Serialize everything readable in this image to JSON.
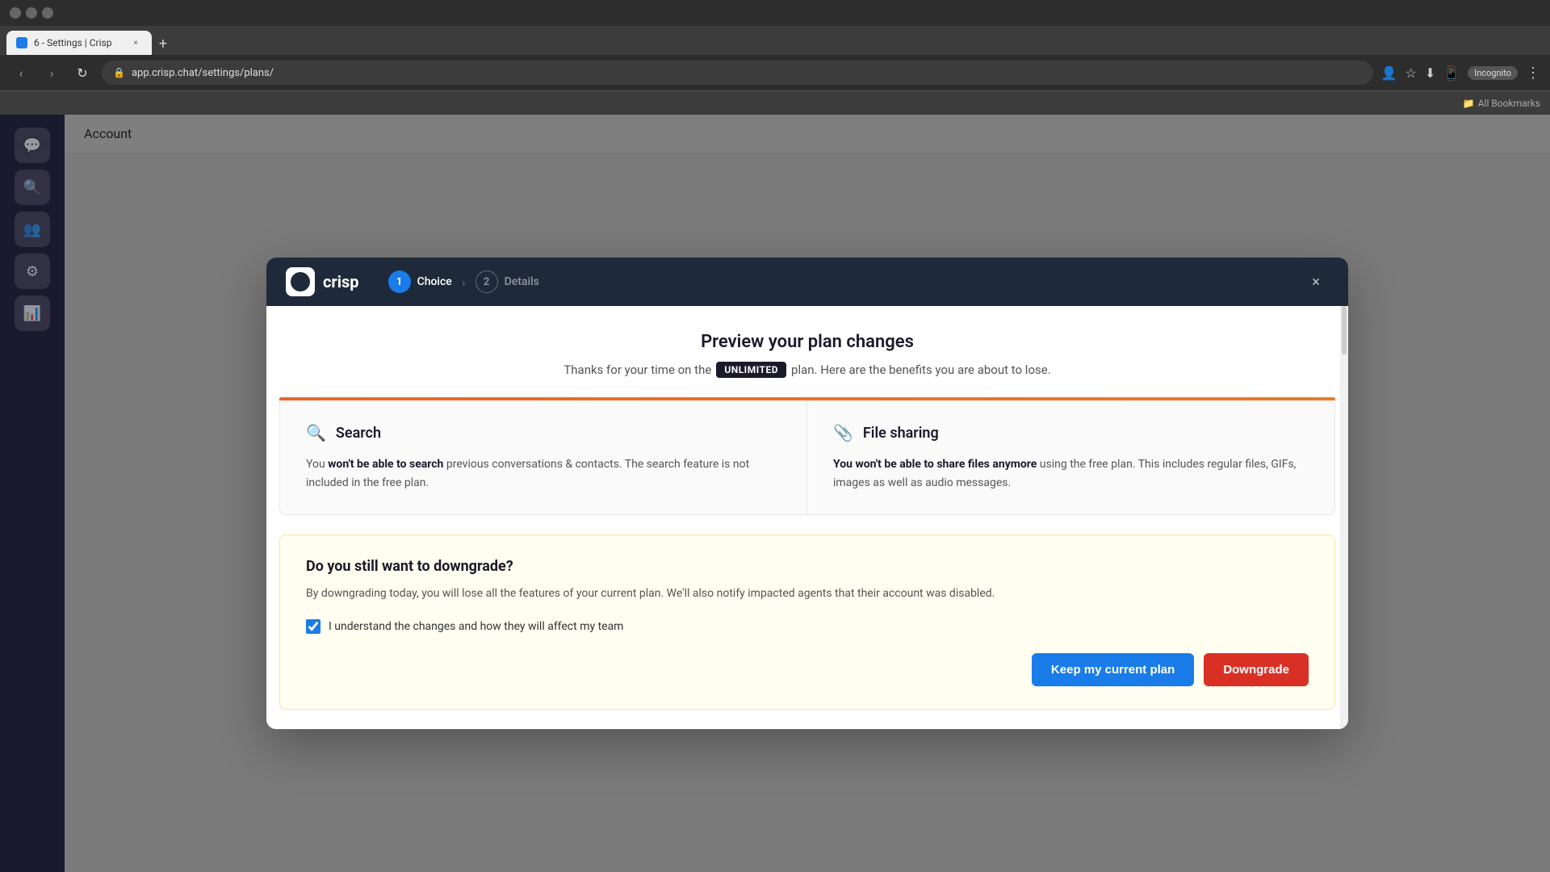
{
  "browser": {
    "tab_title": "6 - Settings | Crisp",
    "url": "app.crisp.chat/settings/plans/",
    "incognito_label": "Incognito",
    "bookmarks_label": "All Bookmarks"
  },
  "modal": {
    "logo_text": "crisp",
    "close_icon": "×",
    "stepper": {
      "step1_num": "1",
      "step1_label": "Choice",
      "step2_num": "2",
      "step2_label": "Details"
    },
    "preview": {
      "title": "Preview your plan changes",
      "subtitle_before": "Thanks for your time on the",
      "plan_badge": "UNLIMITED",
      "subtitle_after": "plan. Here are the benefits you are about to lose."
    },
    "features": {
      "search": {
        "icon": "🔍",
        "title": "Search",
        "desc_plain_before": "You ",
        "desc_bold": "won't be able to search",
        "desc_plain_after": " previous conversations & contacts. The search feature is not included in the free plan."
      },
      "file_sharing": {
        "icon": "📎",
        "title": "File sharing",
        "desc_bold": "You won't be able to share files anymore",
        "desc_plain_after": " using the free plan. This includes regular files, GIFs, images as well as audio messages."
      }
    },
    "downgrade": {
      "title": "Do you still want to downgrade?",
      "description": "By downgrading today, you will lose all the features of your current plan. We'll also notify impacted agents that their account was disabled.",
      "checkbox_label": "I understand the changes and how they will affect my team",
      "checkbox_checked": true,
      "btn_keep_label": "Keep my current plan",
      "btn_downgrade_label": "Downgrade"
    }
  },
  "behind": {
    "header_text": "Account"
  }
}
